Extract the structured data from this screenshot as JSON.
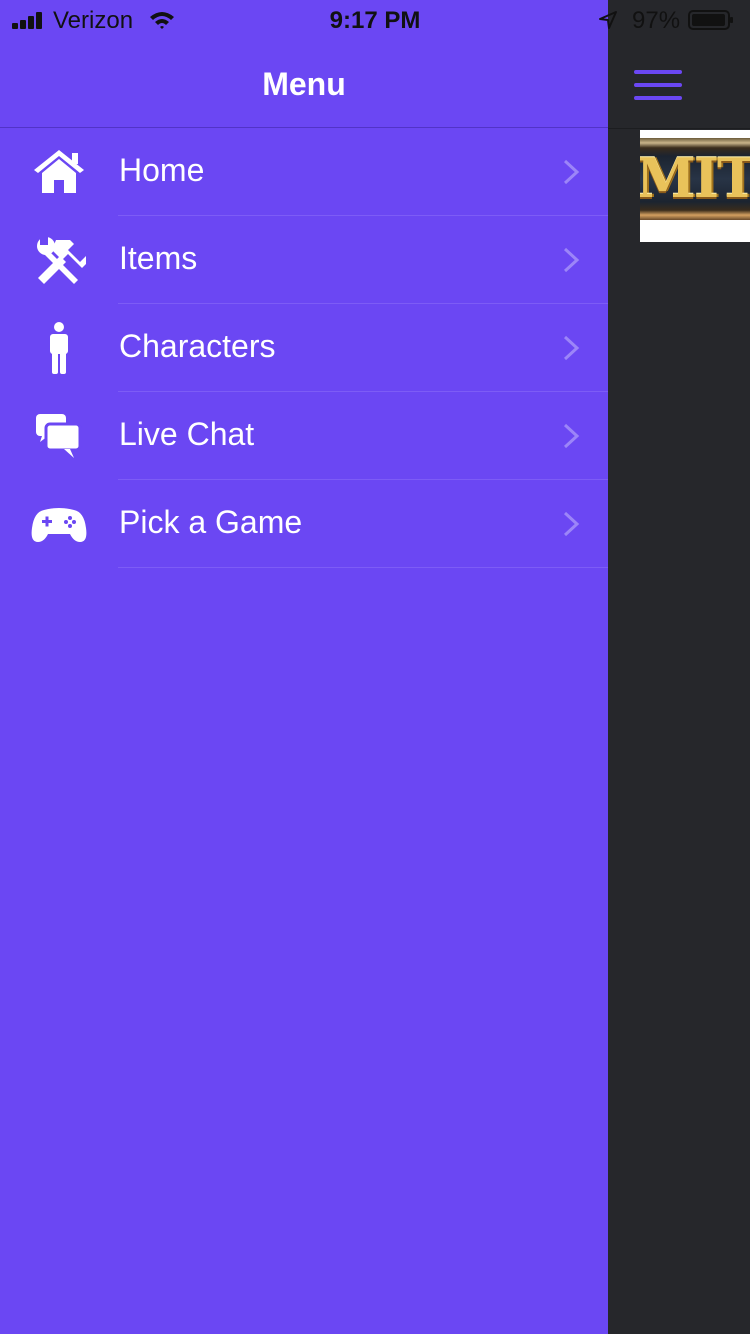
{
  "status_bar": {
    "carrier": "Verizon",
    "time": "9:17 PM",
    "battery_percent": "97%"
  },
  "drawer": {
    "title": "Menu",
    "items": [
      {
        "label": "Home",
        "icon": "home-icon"
      },
      {
        "label": "Items",
        "icon": "tools-icon"
      },
      {
        "label": "Characters",
        "icon": "person-icon"
      },
      {
        "label": "Live Chat",
        "icon": "chat-bubbles-icon"
      },
      {
        "label": "Pick a Game",
        "icon": "gamepad-icon"
      }
    ]
  },
  "content": {
    "banner_text": "MIT"
  },
  "colors": {
    "drawer_background": "#6b47f3",
    "content_background": "#26272b",
    "accent": "#6b47f3",
    "text": "#ffffff"
  }
}
